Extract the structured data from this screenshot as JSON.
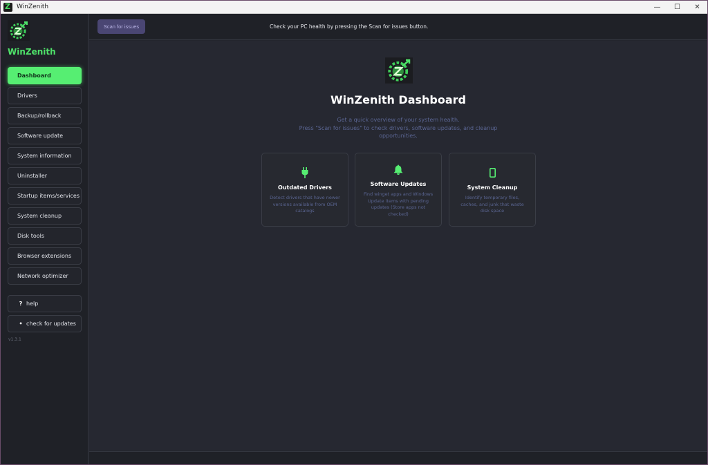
{
  "window": {
    "title": "WinZenith",
    "minimize_glyph": "—",
    "maximize_glyph": "☐",
    "close_glyph": "✕"
  },
  "sidebar": {
    "brand": "WinZenith",
    "items": [
      {
        "label": "Dashboard",
        "active": true
      },
      {
        "label": "Drivers"
      },
      {
        "label": "Backup/rollback"
      },
      {
        "label": "Software update"
      },
      {
        "label": "System information"
      },
      {
        "label": "Uninstaller"
      },
      {
        "label": "Startup items/services"
      },
      {
        "label": "System cleanup"
      },
      {
        "label": "Disk tools"
      },
      {
        "label": "Browser extensions"
      },
      {
        "label": "Network optimizer"
      }
    ],
    "help": {
      "glyph": "?",
      "label": "help"
    },
    "updates": {
      "glyph": "•",
      "label": "check for updates"
    },
    "version": "v1.3.1"
  },
  "toolbar": {
    "scan_label": "Scan for issues",
    "hint": "Check your PC health by pressing the Scan for issues button."
  },
  "dashboard": {
    "title": "WinZenith Dashboard",
    "subtitle_line1": "Get a quick overview of your system health.",
    "subtitle_line2": "Press \"Scan for issues\" to check drivers, software updates, and cleanup opportunities.",
    "cards": [
      {
        "icon": "plug-icon",
        "title": "Outdated Drivers",
        "desc": "Detect drivers that have newer versions available from OEM catalogs"
      },
      {
        "icon": "bell-icon",
        "title": "Software Updates",
        "desc": "Find winget apps and Windows Update items with pending updates (Store apps not checked)"
      },
      {
        "icon": "phone-icon",
        "title": "System Cleanup",
        "desc": "Identify temporary files, caches, and junk that waste disk space"
      }
    ]
  },
  "colors": {
    "accent": "#56ee72",
    "brand": "#4fe36a",
    "scan_button": "#4a4673",
    "muted_text": "#5a6592"
  }
}
